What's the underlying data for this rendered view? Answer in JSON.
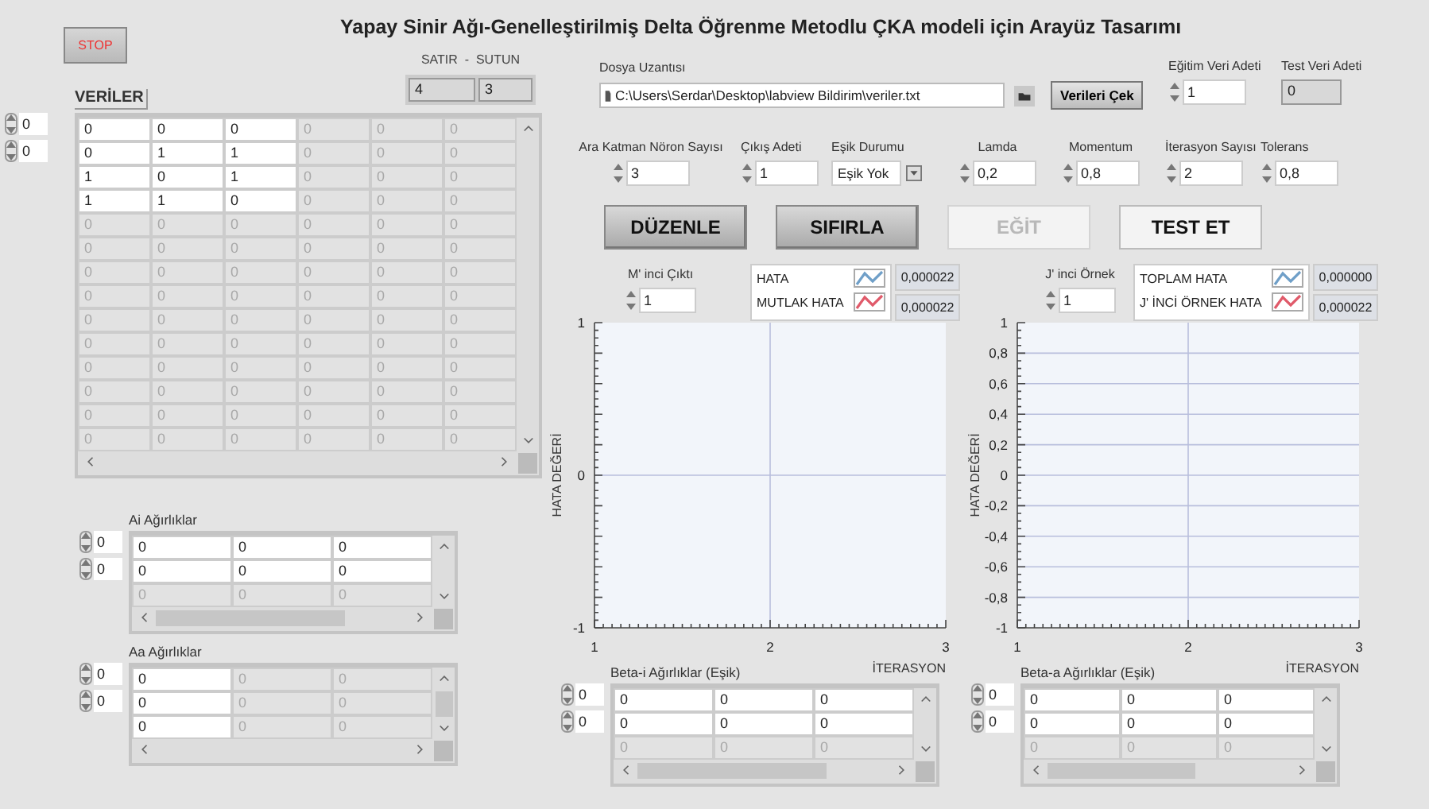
{
  "title": "Yapay Sinir Ağı-Genelleştirilmiş Delta Öğrenme Metodlu ÇKA modeli için Arayüz Tasarımı",
  "stop_button": {
    "label": "STOP"
  },
  "row_col": {
    "label": "SATIR  -  SUTUN",
    "values": [
      "4",
      "3"
    ]
  },
  "data_table": {
    "label": "VERİLER",
    "indices": [
      "0",
      "0"
    ],
    "rows": [
      {
        "cells": [
          {
            "value": "0",
            "filled": true
          },
          {
            "value": "0",
            "filled": true
          },
          {
            "value": "0",
            "filled": true
          },
          {
            "value": "0",
            "filled": false
          },
          {
            "value": "0",
            "filled": false
          },
          {
            "value": "0",
            "filled": false
          }
        ]
      },
      {
        "cells": [
          {
            "value": "0",
            "filled": true
          },
          {
            "value": "1",
            "filled": true
          },
          {
            "value": "1",
            "filled": true
          },
          {
            "value": "0",
            "filled": false
          },
          {
            "value": "0",
            "filled": false
          },
          {
            "value": "0",
            "filled": false
          }
        ]
      },
      {
        "cells": [
          {
            "value": "1",
            "filled": true
          },
          {
            "value": "0",
            "filled": true
          },
          {
            "value": "1",
            "filled": true
          },
          {
            "value": "0",
            "filled": false
          },
          {
            "value": "0",
            "filled": false
          },
          {
            "value": "0",
            "filled": false
          }
        ]
      },
      {
        "cells": [
          {
            "value": "1",
            "filled": true
          },
          {
            "value": "1",
            "filled": true
          },
          {
            "value": "0",
            "filled": true
          },
          {
            "value": "0",
            "filled": false
          },
          {
            "value": "0",
            "filled": false
          },
          {
            "value": "0",
            "filled": false
          }
        ]
      },
      {
        "cells": [
          {
            "value": "0",
            "filled": false
          },
          {
            "value": "0",
            "filled": false
          },
          {
            "value": "0",
            "filled": false
          },
          {
            "value": "0",
            "filled": false
          },
          {
            "value": "0",
            "filled": false
          },
          {
            "value": "0",
            "filled": false
          }
        ]
      },
      {
        "cells": [
          {
            "value": "0",
            "filled": false
          },
          {
            "value": "0",
            "filled": false
          },
          {
            "value": "0",
            "filled": false
          },
          {
            "value": "0",
            "filled": false
          },
          {
            "value": "0",
            "filled": false
          },
          {
            "value": "0",
            "filled": false
          }
        ]
      },
      {
        "cells": [
          {
            "value": "0",
            "filled": false
          },
          {
            "value": "0",
            "filled": false
          },
          {
            "value": "0",
            "filled": false
          },
          {
            "value": "0",
            "filled": false
          },
          {
            "value": "0",
            "filled": false
          },
          {
            "value": "0",
            "filled": false
          }
        ]
      },
      {
        "cells": [
          {
            "value": "0",
            "filled": false
          },
          {
            "value": "0",
            "filled": false
          },
          {
            "value": "0",
            "filled": false
          },
          {
            "value": "0",
            "filled": false
          },
          {
            "value": "0",
            "filled": false
          },
          {
            "value": "0",
            "filled": false
          }
        ]
      },
      {
        "cells": [
          {
            "value": "0",
            "filled": false
          },
          {
            "value": "0",
            "filled": false
          },
          {
            "value": "0",
            "filled": false
          },
          {
            "value": "0",
            "filled": false
          },
          {
            "value": "0",
            "filled": false
          },
          {
            "value": "0",
            "filled": false
          }
        ]
      },
      {
        "cells": [
          {
            "value": "0",
            "filled": false
          },
          {
            "value": "0",
            "filled": false
          },
          {
            "value": "0",
            "filled": false
          },
          {
            "value": "0",
            "filled": false
          },
          {
            "value": "0",
            "filled": false
          },
          {
            "value": "0",
            "filled": false
          }
        ]
      },
      {
        "cells": [
          {
            "value": "0",
            "filled": false
          },
          {
            "value": "0",
            "filled": false
          },
          {
            "value": "0",
            "filled": false
          },
          {
            "value": "0",
            "filled": false
          },
          {
            "value": "0",
            "filled": false
          },
          {
            "value": "0",
            "filled": false
          }
        ]
      },
      {
        "cells": [
          {
            "value": "0",
            "filled": false
          },
          {
            "value": "0",
            "filled": false
          },
          {
            "value": "0",
            "filled": false
          },
          {
            "value": "0",
            "filled": false
          },
          {
            "value": "0",
            "filled": false
          },
          {
            "value": "0",
            "filled": false
          }
        ]
      },
      {
        "cells": [
          {
            "value": "0",
            "filled": false
          },
          {
            "value": "0",
            "filled": false
          },
          {
            "value": "0",
            "filled": false
          },
          {
            "value": "0",
            "filled": false
          },
          {
            "value": "0",
            "filled": false
          },
          {
            "value": "0",
            "filled": false
          }
        ]
      },
      {
        "cells": [
          {
            "value": "0",
            "filled": false
          },
          {
            "value": "0",
            "filled": false
          },
          {
            "value": "0",
            "filled": false
          },
          {
            "value": "0",
            "filled": false
          },
          {
            "value": "0",
            "filled": false
          },
          {
            "value": "0",
            "filled": false
          }
        ]
      }
    ]
  },
  "file_path": {
    "label": "Dosya Uzantısı",
    "value": "C:\\Users\\Serdar\\Desktop\\labview Bildirim\\veriler.txt",
    "button": "Verileri Çek"
  },
  "train_count": {
    "label": "Eğitim Veri Adeti",
    "value": "1"
  },
  "test_count": {
    "label": "Test Veri Adeti",
    "value": "0"
  },
  "parameters": [
    {
      "kind": "numeric",
      "label": "Ara Katman Nöron Sayısı",
      "value": "3"
    },
    {
      "kind": "numeric",
      "label": "Çıkış Adeti",
      "value": "1"
    },
    {
      "kind": "dropdown",
      "label": "Eşik Durumu",
      "value": "Eşik Yok"
    },
    {
      "kind": "numeric",
      "label": "Lamda",
      "value": "0,2"
    },
    {
      "kind": "numeric",
      "label": "Momentum",
      "value": "0,8"
    },
    {
      "kind": "numeric",
      "label": "İterasyon Sayısı",
      "value": "2"
    },
    {
      "kind": "numeric",
      "label": "Tolerans",
      "value": "0,8"
    }
  ],
  "action_buttons": [
    {
      "label": "DÜZENLE",
      "kind": "raised",
      "disabled": false
    },
    {
      "label": "SIFIRLA",
      "kind": "raised",
      "disabled": false
    },
    {
      "label": "EĞİT",
      "kind": "flat",
      "disabled": true
    },
    {
      "label": "TEST ET",
      "kind": "flat",
      "disabled": false
    }
  ],
  "error_chart": {
    "selector": {
      "label": "M' inci Çıktı",
      "value": "1"
    },
    "legend": [
      {
        "name": "HATA",
        "color": "#6f9fc8",
        "reading": "0,000022"
      },
      {
        "name": "MUTLAK HATA",
        "color": "#e05a6a",
        "reading": "0,000022"
      }
    ],
    "chart_data": {
      "type": "line",
      "xlabel": "İTERASYON",
      "ylabel": "HATA DEĞERİ",
      "xlim": [
        1,
        3
      ],
      "ylim": [
        -1,
        1
      ],
      "xticks": [
        1,
        2,
        3
      ],
      "yticks": [
        -1,
        0,
        1
      ],
      "grid": true
    }
  },
  "ai_weights": {
    "label": "Ai Ağırlıklar",
    "indices": [
      "0",
      "0"
    ],
    "rows": [
      {
        "cells": [
          {
            "value": "0",
            "filled": true
          },
          {
            "value": "0",
            "filled": true
          },
          {
            "value": "0",
            "filled": true
          }
        ]
      },
      {
        "cells": [
          {
            "value": "0",
            "filled": true
          },
          {
            "value": "0",
            "filled": true
          },
          {
            "value": "0",
            "filled": true
          }
        ]
      },
      {
        "cells": [
          {
            "value": "0",
            "filled": false
          },
          {
            "value": "0",
            "filled": false
          },
          {
            "value": "0",
            "filled": false
          }
        ]
      }
    ]
  },
  "aa_weights": {
    "label": "Aa Ağırlıklar",
    "indices": [
      "0",
      "0"
    ],
    "rows": [
      {
        "cells": [
          {
            "value": "0",
            "filled": true
          },
          {
            "value": "0",
            "filled": false
          },
          {
            "value": "0",
            "filled": false
          }
        ]
      },
      {
        "cells": [
          {
            "value": "0",
            "filled": true
          },
          {
            "value": "0",
            "filled": false
          },
          {
            "value": "0",
            "filled": false
          }
        ]
      },
      {
        "cells": [
          {
            "value": "0",
            "filled": true
          },
          {
            "value": "0",
            "filled": false
          },
          {
            "value": "0",
            "filled": false
          }
        ]
      }
    ]
  },
  "beta_i_weights": {
    "label": "Beta-i Ağırlıklar (Eşik)",
    "indices": [
      "0",
      "0"
    ],
    "rows": [
      {
        "cells": [
          {
            "value": "0",
            "filled": true
          },
          {
            "value": "0",
            "filled": true
          },
          {
            "value": "0",
            "filled": true
          }
        ]
      },
      {
        "cells": [
          {
            "value": "0",
            "filled": true
          },
          {
            "value": "0",
            "filled": true
          },
          {
            "value": "0",
            "filled": true
          }
        ]
      },
      {
        "cells": [
          {
            "value": "0",
            "filled": false
          },
          {
            "value": "0",
            "filled": false
          },
          {
            "value": "0",
            "filled": false
          }
        ]
      }
    ]
  },
  "sample_chart": {
    "selector": {
      "label": "J' inci Örnek",
      "value": "1"
    },
    "legend": [
      {
        "name": "TOPLAM HATA",
        "color": "#6f9fc8",
        "reading": "0,000000"
      },
      {
        "name": "J' İNCİ ÖRNEK HATA",
        "color": "#e05a6a",
        "reading": "0,000022"
      }
    ],
    "chart_data": {
      "type": "line",
      "xlabel": "İTERASYON",
      "ylabel": "HATA DEĞERİ",
      "xlim": [
        1,
        3
      ],
      "ylim": [
        -1,
        1
      ],
      "xticks": [
        1,
        2,
        3
      ],
      "yticks": [
        {
          "value": 1,
          "label": "1"
        },
        {
          "value": 0.8,
          "label": "0,8"
        },
        {
          "value": 0.6,
          "label": "0,6"
        },
        {
          "value": 0.4,
          "label": "0,4"
        },
        {
          "value": 0.2,
          "label": "0,2"
        },
        {
          "value": 0,
          "label": "0"
        },
        {
          "value": -0.2,
          "label": "-0,2"
        },
        {
          "value": -0.4,
          "label": "-0,4"
        },
        {
          "value": -0.6,
          "label": "-0,6"
        },
        {
          "value": -0.8,
          "label": "-0,8"
        },
        {
          "value": -1,
          "label": "-1"
        }
      ],
      "grid": true
    }
  },
  "beta_a_weights": {
    "label": "Beta-a Ağırlıklar (Eşik)",
    "indices": [
      "0",
      "0"
    ],
    "rows": [
      {
        "cells": [
          {
            "value": "0",
            "filled": true
          },
          {
            "value": "0",
            "filled": true
          },
          {
            "value": "0",
            "filled": true
          }
        ]
      },
      {
        "cells": [
          {
            "value": "0",
            "filled": true
          },
          {
            "value": "0",
            "filled": true
          },
          {
            "value": "0",
            "filled": true
          }
        ]
      },
      {
        "cells": [
          {
            "value": "0",
            "filled": false
          },
          {
            "value": "0",
            "filled": false
          },
          {
            "value": "0",
            "filled": false
          }
        ]
      }
    ]
  }
}
